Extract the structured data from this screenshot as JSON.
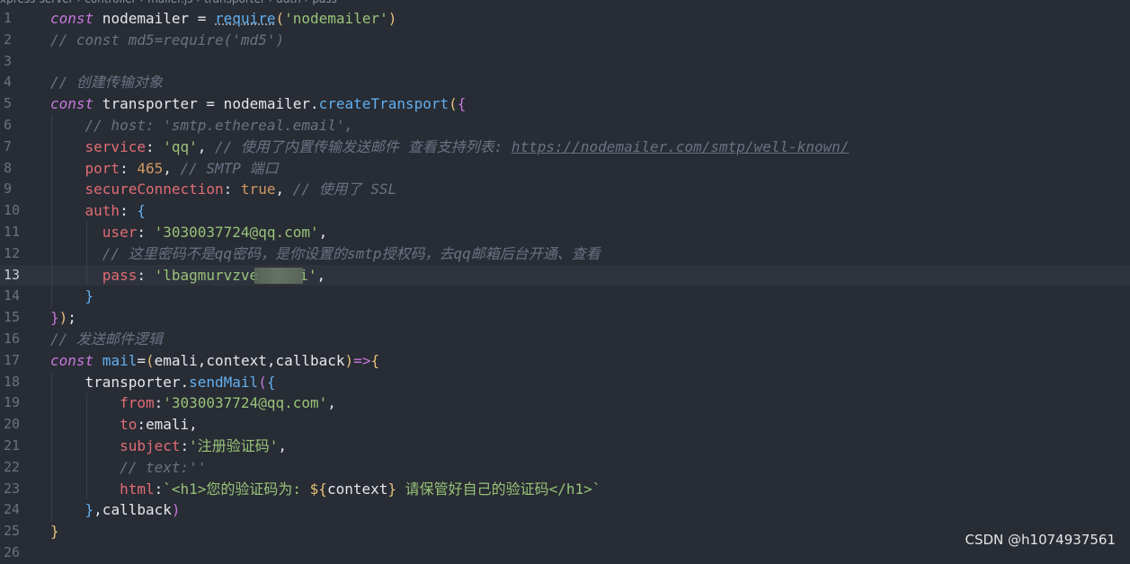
{
  "breadcrumb": [
    "xpress-server",
    "controller",
    "mailer.js",
    "transporter",
    "auth",
    "pass"
  ],
  "watermark": "CSDN @h1074937561",
  "active_line": 13,
  "lines": [
    {
      "n": "1",
      "t": [
        [
          "kw",
          "const"
        ],
        [
          "id",
          " nodemailer "
        ],
        [
          "op",
          "="
        ],
        [
          "id",
          " "
        ],
        [
          "fn",
          "require"
        ],
        [
          "p1",
          "("
        ],
        [
          "str",
          "'nodemailer'"
        ],
        [
          "p1",
          ")"
        ]
      ]
    },
    {
      "n": "2",
      "t": [
        [
          "cm",
          "// const md5=require('md5')"
        ]
      ]
    },
    {
      "n": "3",
      "t": []
    },
    {
      "n": "4",
      "t": [
        [
          "cm",
          "// 创建传输对象"
        ]
      ]
    },
    {
      "n": "5",
      "t": [
        [
          "kw",
          "const"
        ],
        [
          "id",
          " transporter "
        ],
        [
          "op",
          "="
        ],
        [
          "id",
          " nodemailer."
        ],
        [
          "fn",
          "createTransport"
        ],
        [
          "p1",
          "("
        ],
        [
          "p2",
          "{"
        ]
      ]
    },
    {
      "n": "6",
      "t": [
        [
          "id",
          "    "
        ],
        [
          "cm",
          "// host: 'smtp.ethereal.email',"
        ]
      ]
    },
    {
      "n": "7",
      "t": [
        [
          "id",
          "    "
        ],
        [
          "prop",
          "service"
        ],
        [
          "op",
          ": "
        ],
        [
          "str",
          "'qq'"
        ],
        [
          "op",
          ", "
        ],
        [
          "cm",
          "// 使用了内置传输发送邮件 查看支持列表: "
        ],
        [
          "link",
          "https://nodemailer.com/smtp/well-known/"
        ]
      ]
    },
    {
      "n": "8",
      "t": [
        [
          "id",
          "    "
        ],
        [
          "prop",
          "port"
        ],
        [
          "op",
          ": "
        ],
        [
          "num",
          "465"
        ],
        [
          "op",
          ", "
        ],
        [
          "cm",
          "// SMTP 端口"
        ]
      ]
    },
    {
      "n": "9",
      "t": [
        [
          "id",
          "    "
        ],
        [
          "prop",
          "secureConnection"
        ],
        [
          "op",
          ": "
        ],
        [
          "bool",
          "true"
        ],
        [
          "op",
          ", "
        ],
        [
          "cm",
          "// 使用了 SSL"
        ]
      ]
    },
    {
      "n": "10",
      "t": [
        [
          "id",
          "    "
        ],
        [
          "prop",
          "auth"
        ],
        [
          "op",
          ": "
        ],
        [
          "p3",
          "{"
        ]
      ]
    },
    {
      "n": "11",
      "t": [
        [
          "id",
          "      "
        ],
        [
          "prop",
          "user"
        ],
        [
          "op",
          ": "
        ],
        [
          "str",
          "'3030037724@qq.com'"
        ],
        [
          "op",
          ","
        ]
      ]
    },
    {
      "n": "12",
      "t": [
        [
          "id",
          "      "
        ],
        [
          "cm",
          "// 这里密码不是qq密码，是你设置的smtp授权码，去qq邮箱后台开通、查看"
        ]
      ]
    },
    {
      "n": "13",
      "t": [
        [
          "id",
          "      "
        ],
        [
          "prop",
          "pass"
        ],
        [
          "op",
          ": "
        ],
        [
          "str",
          "'lbagmurvzve"
        ],
        [
          "blur",
          ""
        ],
        [
          "str",
          "i'"
        ],
        [
          "op",
          ","
        ]
      ]
    },
    {
      "n": "14",
      "t": [
        [
          "id",
          "    "
        ],
        [
          "p3",
          "}"
        ]
      ]
    },
    {
      "n": "15",
      "t": [
        [
          "p2",
          "}"
        ],
        [
          "p1",
          ")"
        ],
        [
          "op",
          ";"
        ]
      ]
    },
    {
      "n": "16",
      "t": [
        [
          "cm",
          "// 发送邮件逻辑"
        ]
      ]
    },
    {
      "n": "17",
      "t": [
        [
          "kw",
          "const"
        ],
        [
          "id",
          " "
        ],
        [
          "fn",
          "mail"
        ],
        [
          "op",
          "="
        ],
        [
          "p1",
          "("
        ],
        [
          "id",
          "emali,context,callback"
        ],
        [
          "p1",
          ")"
        ],
        [
          "kw",
          "=>"
        ],
        [
          "p1",
          "{"
        ]
      ]
    },
    {
      "n": "18",
      "t": [
        [
          "id",
          "    transporter."
        ],
        [
          "fn",
          "sendMail"
        ],
        [
          "p2",
          "("
        ],
        [
          "p3",
          "{"
        ]
      ]
    },
    {
      "n": "19",
      "t": [
        [
          "id",
          "        "
        ],
        [
          "prop",
          "from"
        ],
        [
          "op",
          ":"
        ],
        [
          "str",
          "'3030037724@qq.com'"
        ],
        [
          "op",
          ","
        ]
      ]
    },
    {
      "n": "20",
      "t": [
        [
          "id",
          "        "
        ],
        [
          "prop",
          "to"
        ],
        [
          "op",
          ":"
        ],
        [
          "id",
          "emali"
        ],
        [
          "op",
          ","
        ]
      ]
    },
    {
      "n": "21",
      "t": [
        [
          "id",
          "        "
        ],
        [
          "prop",
          "subject"
        ],
        [
          "op",
          ":"
        ],
        [
          "str",
          "'注册验证码'"
        ],
        [
          "op",
          ","
        ]
      ]
    },
    {
      "n": "22",
      "t": [
        [
          "id",
          "        "
        ],
        [
          "cm",
          "// text:''"
        ]
      ]
    },
    {
      "n": "23",
      "t": [
        [
          "id",
          "        "
        ],
        [
          "prop",
          "html"
        ],
        [
          "op",
          ":"
        ],
        [
          "tpl",
          "`<h1>您的验证码为: "
        ],
        [
          "p1",
          "${"
        ],
        [
          "id",
          "context"
        ],
        [
          "p1",
          "}"
        ],
        [
          "tpl",
          " 请保管好自己的验证码</h1>`"
        ]
      ]
    },
    {
      "n": "24",
      "t": [
        [
          "id",
          "    "
        ],
        [
          "p3",
          "}"
        ],
        [
          "id",
          ",callback"
        ],
        [
          "p2",
          ")"
        ]
      ]
    },
    {
      "n": "25",
      "t": [
        [
          "p1",
          "}"
        ]
      ]
    },
    {
      "n": "26",
      "t": []
    }
  ]
}
